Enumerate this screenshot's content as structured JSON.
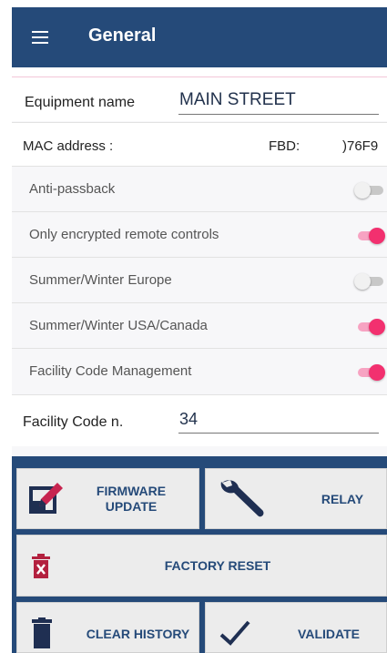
{
  "appbar": {
    "title": "General",
    "menu_icon": "hamburger-menu-icon"
  },
  "equipment": {
    "label": "Equipment name",
    "value": "MAIN STREET"
  },
  "mac": {
    "label": "MAC address :",
    "value_prefix": "FBD:",
    "value_suffix": ")76F9"
  },
  "toggles": [
    {
      "label": "Anti-passback",
      "state": "off"
    },
    {
      "label": "Only encrypted remote controls",
      "state": "on"
    },
    {
      "label": "Summer/Winter Europe",
      "state": "off"
    },
    {
      "label": "Summer/Winter USA/Canada",
      "state": "on"
    },
    {
      "label": "Facility Code Management",
      "state": "on"
    }
  ],
  "facility_code": {
    "label": "Facility Code n.",
    "value": "34"
  },
  "buttons": {
    "firmware_update_line1": "FIRMWARE",
    "firmware_update_line2": "UPDATE",
    "relay": "RELAY",
    "factory_reset": "FACTORY RESET",
    "clear_history": "CLEAR HISTORY",
    "validate": "VALIDATE"
  },
  "colors": {
    "header": "#254a79",
    "accent": "#f2306f",
    "button_text": "#254a79"
  }
}
